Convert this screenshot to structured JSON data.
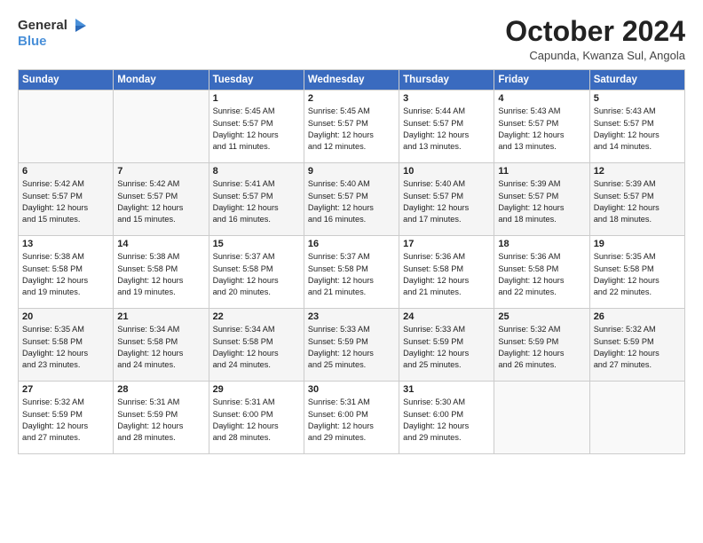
{
  "header": {
    "logo_line1": "General",
    "logo_line2": "Blue",
    "month": "October 2024",
    "location": "Capunda, Kwanza Sul, Angola"
  },
  "days_of_week": [
    "Sunday",
    "Monday",
    "Tuesday",
    "Wednesday",
    "Thursday",
    "Friday",
    "Saturday"
  ],
  "weeks": [
    [
      {
        "day": "",
        "info": ""
      },
      {
        "day": "",
        "info": ""
      },
      {
        "day": "1",
        "info": "Sunrise: 5:45 AM\nSunset: 5:57 PM\nDaylight: 12 hours\nand 11 minutes."
      },
      {
        "day": "2",
        "info": "Sunrise: 5:45 AM\nSunset: 5:57 PM\nDaylight: 12 hours\nand 12 minutes."
      },
      {
        "day": "3",
        "info": "Sunrise: 5:44 AM\nSunset: 5:57 PM\nDaylight: 12 hours\nand 13 minutes."
      },
      {
        "day": "4",
        "info": "Sunrise: 5:43 AM\nSunset: 5:57 PM\nDaylight: 12 hours\nand 13 minutes."
      },
      {
        "day": "5",
        "info": "Sunrise: 5:43 AM\nSunset: 5:57 PM\nDaylight: 12 hours\nand 14 minutes."
      }
    ],
    [
      {
        "day": "6",
        "info": "Sunrise: 5:42 AM\nSunset: 5:57 PM\nDaylight: 12 hours\nand 15 minutes."
      },
      {
        "day": "7",
        "info": "Sunrise: 5:42 AM\nSunset: 5:57 PM\nDaylight: 12 hours\nand 15 minutes."
      },
      {
        "day": "8",
        "info": "Sunrise: 5:41 AM\nSunset: 5:57 PM\nDaylight: 12 hours\nand 16 minutes."
      },
      {
        "day": "9",
        "info": "Sunrise: 5:40 AM\nSunset: 5:57 PM\nDaylight: 12 hours\nand 16 minutes."
      },
      {
        "day": "10",
        "info": "Sunrise: 5:40 AM\nSunset: 5:57 PM\nDaylight: 12 hours\nand 17 minutes."
      },
      {
        "day": "11",
        "info": "Sunrise: 5:39 AM\nSunset: 5:57 PM\nDaylight: 12 hours\nand 18 minutes."
      },
      {
        "day": "12",
        "info": "Sunrise: 5:39 AM\nSunset: 5:57 PM\nDaylight: 12 hours\nand 18 minutes."
      }
    ],
    [
      {
        "day": "13",
        "info": "Sunrise: 5:38 AM\nSunset: 5:58 PM\nDaylight: 12 hours\nand 19 minutes."
      },
      {
        "day": "14",
        "info": "Sunrise: 5:38 AM\nSunset: 5:58 PM\nDaylight: 12 hours\nand 19 minutes."
      },
      {
        "day": "15",
        "info": "Sunrise: 5:37 AM\nSunset: 5:58 PM\nDaylight: 12 hours\nand 20 minutes."
      },
      {
        "day": "16",
        "info": "Sunrise: 5:37 AM\nSunset: 5:58 PM\nDaylight: 12 hours\nand 21 minutes."
      },
      {
        "day": "17",
        "info": "Sunrise: 5:36 AM\nSunset: 5:58 PM\nDaylight: 12 hours\nand 21 minutes."
      },
      {
        "day": "18",
        "info": "Sunrise: 5:36 AM\nSunset: 5:58 PM\nDaylight: 12 hours\nand 22 minutes."
      },
      {
        "day": "19",
        "info": "Sunrise: 5:35 AM\nSunset: 5:58 PM\nDaylight: 12 hours\nand 22 minutes."
      }
    ],
    [
      {
        "day": "20",
        "info": "Sunrise: 5:35 AM\nSunset: 5:58 PM\nDaylight: 12 hours\nand 23 minutes."
      },
      {
        "day": "21",
        "info": "Sunrise: 5:34 AM\nSunset: 5:58 PM\nDaylight: 12 hours\nand 24 minutes."
      },
      {
        "day": "22",
        "info": "Sunrise: 5:34 AM\nSunset: 5:58 PM\nDaylight: 12 hours\nand 24 minutes."
      },
      {
        "day": "23",
        "info": "Sunrise: 5:33 AM\nSunset: 5:59 PM\nDaylight: 12 hours\nand 25 minutes."
      },
      {
        "day": "24",
        "info": "Sunrise: 5:33 AM\nSunset: 5:59 PM\nDaylight: 12 hours\nand 25 minutes."
      },
      {
        "day": "25",
        "info": "Sunrise: 5:32 AM\nSunset: 5:59 PM\nDaylight: 12 hours\nand 26 minutes."
      },
      {
        "day": "26",
        "info": "Sunrise: 5:32 AM\nSunset: 5:59 PM\nDaylight: 12 hours\nand 27 minutes."
      }
    ],
    [
      {
        "day": "27",
        "info": "Sunrise: 5:32 AM\nSunset: 5:59 PM\nDaylight: 12 hours\nand 27 minutes."
      },
      {
        "day": "28",
        "info": "Sunrise: 5:31 AM\nSunset: 5:59 PM\nDaylight: 12 hours\nand 28 minutes."
      },
      {
        "day": "29",
        "info": "Sunrise: 5:31 AM\nSunset: 6:00 PM\nDaylight: 12 hours\nand 28 minutes."
      },
      {
        "day": "30",
        "info": "Sunrise: 5:31 AM\nSunset: 6:00 PM\nDaylight: 12 hours\nand 29 minutes."
      },
      {
        "day": "31",
        "info": "Sunrise: 5:30 AM\nSunset: 6:00 PM\nDaylight: 12 hours\nand 29 minutes."
      },
      {
        "day": "",
        "info": ""
      },
      {
        "day": "",
        "info": ""
      }
    ]
  ]
}
